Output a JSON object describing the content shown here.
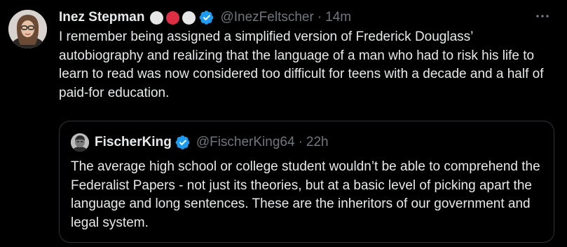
{
  "colors": {
    "background": "#000000",
    "text_primary": "#e7e9ea",
    "text_secondary": "#71767b",
    "verified_blue": "#1d9bf0",
    "border": "#2f3336"
  },
  "tweet": {
    "author_name": "Inez Stepman",
    "name_emojis": [
      {
        "icon": "white-circle-emoji",
        "color": "#e6e6e6"
      },
      {
        "icon": "red-circle-emoji",
        "color": "#dd2e44"
      },
      {
        "icon": "white-circle-emoji",
        "color": "#e6e6e6"
      }
    ],
    "verified_icon": "verified-badge-icon",
    "handle": "@InezFeltscher",
    "separator": "·",
    "time": "14m",
    "more_icon": "more-options-icon",
    "text": "I remember being assigned a simplified version of Frederick Douglass’ autobiography and realizing that the language of a man who had to risk his life to learn to read was now considered too difficult for teens with a decade and a half of paid-for education."
  },
  "quoted_tweet": {
    "author_name": "FischerKing",
    "verified_icon": "verified-badge-icon",
    "handle": "@FischerKing64",
    "separator": "·",
    "time": "22h",
    "text": "The average high school or college student wouldn’t be able to comprehend the Federalist Papers - not just its theories, but at a basic level of picking apart the language and long sentences. These are the inheritors of our government and legal system."
  }
}
